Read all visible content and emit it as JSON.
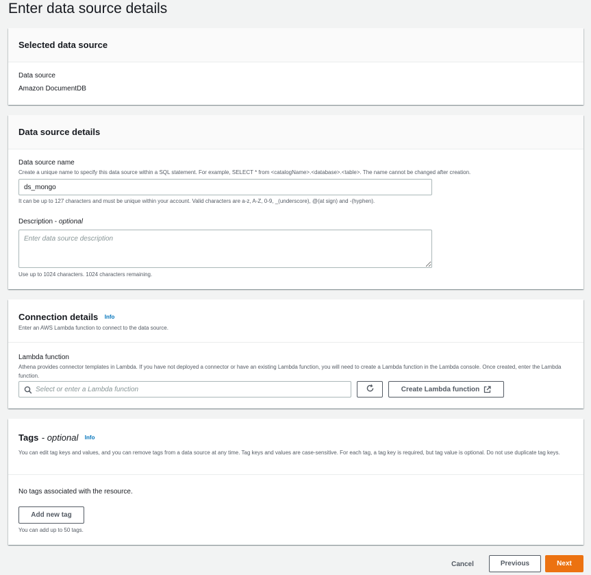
{
  "page": {
    "title": "Enter data source details"
  },
  "selected_source": {
    "heading": "Selected data source",
    "label": "Data source",
    "value": "Amazon DocumentDB"
  },
  "details": {
    "heading": "Data source details",
    "name_label": "Data source name",
    "name_description": "Create a unique name to specify this data source within a SQL statement. For example, SELECT * from <catalogName>.<database>.<table>. The name cannot be changed after creation.",
    "name_value": "ds_mongo",
    "name_hint": "It can be up to 127 characters and must be unique within your account. Valid characters are a-z, A-Z, 0-9, _(underscore), @(at sign) and -(hyphen).",
    "description_label": "Description",
    "description_optional": "optional",
    "description_placeholder": "Enter data source description",
    "description_hint": "Use up to 1024 characters. 1024 characters remaining."
  },
  "connection": {
    "heading": "Connection details",
    "info": "Info",
    "subheading": "Enter an AWS Lambda function to connect to the data source.",
    "lambda_label": "Lambda function",
    "lambda_description": "Athena provides connector templates in Lambda. If you have not deployed a connector or have an existing Lambda function, you will need to create a Lambda function in the Lambda console. Once created, enter the Lambda function.",
    "lambda_placeholder": "Select or enter a Lambda function",
    "create_button": "Create Lambda function"
  },
  "tags": {
    "heading": "Tags",
    "optional": "optional",
    "info": "Info",
    "description": "You can edit tag keys and values, and you can remove tags from a data source at any time. Tag keys and values are case-sensitive. For each tag, a tag key is required, but tag value is optional. Do not use duplicate tag keys.",
    "empty": "No tags associated with the resource.",
    "add_button": "Add new tag",
    "limit": "You can add up to 50 tags."
  },
  "footer": {
    "cancel": "Cancel",
    "previous": "Previous",
    "next": "Next"
  },
  "colors": {
    "primary": "#ec7211",
    "link": "#0073bb",
    "background": "#f2f3f3"
  }
}
